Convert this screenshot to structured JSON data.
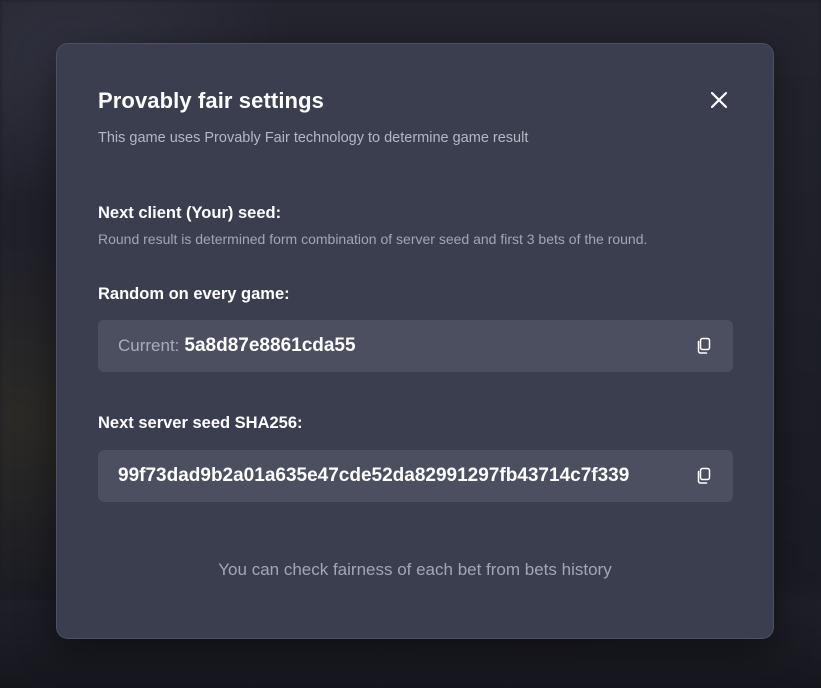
{
  "modal": {
    "title": "Provably fair settings",
    "subtitle": "This game uses Provably Fair technology to determine game result",
    "close_icon": "close-icon"
  },
  "client_seed": {
    "label": "Next client (Your) seed:",
    "description": "Round result is determined form combination of server seed and first 3 bets of the round.",
    "mode_label": "Random on every game:",
    "current_prefix": "Current:",
    "current_value": "5a8d87e8861cda55",
    "copy_icon": "copy-icon"
  },
  "server_seed": {
    "label": "Next server seed SHA256:",
    "value": "99f73dad9b2a01a635e47cde52da82991297fb43714c7f339",
    "copy_icon": "copy-icon"
  },
  "footer": {
    "note": "You can check fairness of each bet from bets history"
  },
  "colors": {
    "modal_bg": "#3b3e4e",
    "field_bg": "#4c4f60",
    "text_primary": "#ffffff",
    "text_muted": "#a3a6b4"
  }
}
